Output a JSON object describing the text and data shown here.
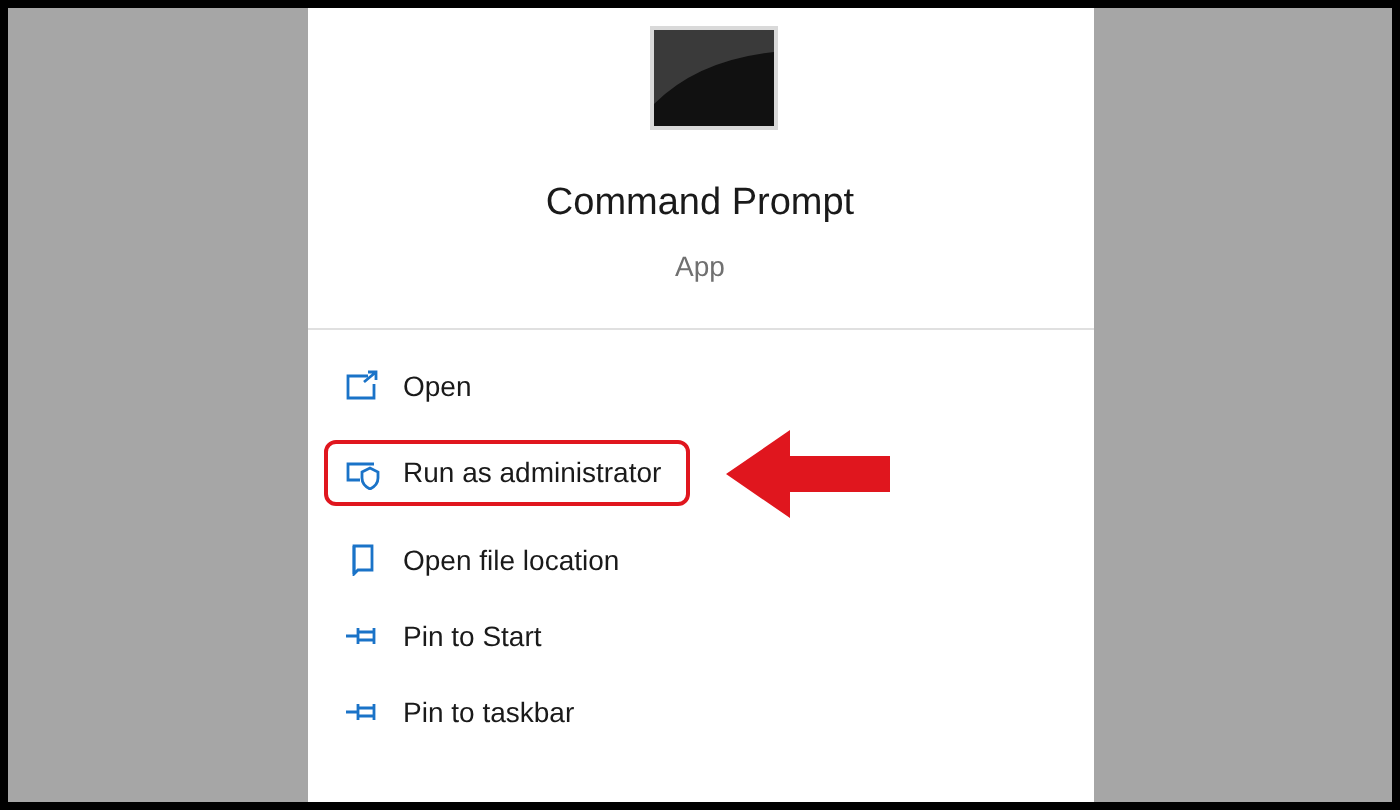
{
  "app": {
    "title": "Command Prompt",
    "subtitle": "App"
  },
  "actions": [
    {
      "kind": "open",
      "label": "Open",
      "highlighted": false
    },
    {
      "kind": "admin",
      "label": "Run as administrator",
      "highlighted": true
    },
    {
      "kind": "folder",
      "label": "Open file location",
      "highlighted": false
    },
    {
      "kind": "pin",
      "label": "Pin to Start",
      "highlighted": false
    },
    {
      "kind": "pin",
      "label": "Pin to taskbar",
      "highlighted": false
    }
  ]
}
